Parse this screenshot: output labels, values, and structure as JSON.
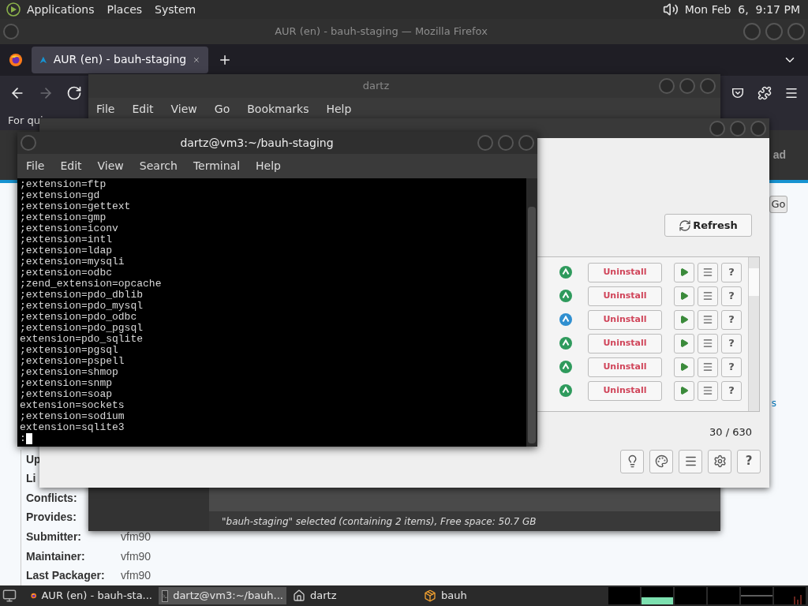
{
  "top_panel": {
    "menus": [
      "Applications",
      "Places",
      "System"
    ],
    "clock": "Mon Feb  6,  9:17 PM"
  },
  "firefox": {
    "title": "AUR (en) - bauh-staging — Mozilla Firefox",
    "tabs": [
      {
        "label": "AUR (en) - bauh-staging",
        "selected": true
      }
    ],
    "nav_buttons": [
      {
        "kind": "back",
        "disabled": false
      },
      {
        "kind": "forward",
        "disabled": true
      },
      {
        "kind": "reload",
        "disabled": false
      }
    ],
    "bookmarks_text": "For qui",
    "header_text": "ad",
    "go_button": "Go",
    "side_text": "s",
    "details": [
      {
        "label": "Up"
      },
      {
        "label": "Li"
      },
      {
        "label": "Conflicts:"
      },
      {
        "label": "Provides:"
      },
      {
        "label": "Submitter:",
        "value": "vfm90"
      },
      {
        "label": "Maintainer:",
        "value": "vfm90"
      },
      {
        "label": "Last Packager:",
        "value": "vfm90"
      }
    ]
  },
  "file_manager": {
    "title": "dartz",
    "menu": [
      "File",
      "Edit",
      "View",
      "Go",
      "Bookmarks",
      "Help"
    ],
    "status": "\"bauh-staging\" selected (containing 2 items), Free space: 50.7 GB"
  },
  "bauh": {
    "refresh": "Refresh",
    "rows": [
      {
        "color": "#2e9a5c",
        "action": "Uninstall",
        "info": "?"
      },
      {
        "color": "#2e9a5c",
        "action": "Uninstall",
        "info": "?"
      },
      {
        "color": "#2f8fd0",
        "action": "Uninstall",
        "info": "?"
      },
      {
        "color": "#2e9a5c",
        "action": "Uninstall",
        "info": "?"
      },
      {
        "color": "#2e9a5c",
        "action": "Uninstall",
        "info": "?"
      },
      {
        "color": "#2e9a5c",
        "action": "Uninstall",
        "info": "?"
      }
    ],
    "count": "30 / 630",
    "help": "?"
  },
  "terminal": {
    "title": "dartz@vm3:~/bauh-staging",
    "menu": [
      "File",
      "Edit",
      "View",
      "Search",
      "Terminal",
      "Help"
    ],
    "lines": [
      ";extension=ftp",
      ";extension=gd",
      ";extension=gettext",
      ";extension=gmp",
      ";extension=iconv",
      ";extension=intl",
      ";extension=ldap",
      ";extension=mysqli",
      ";extension=odbc",
      ";zend_extension=opcache",
      ";extension=pdo_dblib",
      ";extension=pdo_mysql",
      ";extension=pdo_odbc",
      ";extension=pdo_pgsql",
      "extension=pdo_sqlite",
      ";extension=pgsql",
      ";extension=pspell",
      ";extension=shmop",
      ";extension=snmp",
      ";extension=soap",
      "extension=sockets",
      ";extension=sodium",
      "extension=sqlite3"
    ],
    "prompt": ":"
  },
  "taskbar": {
    "items": [
      {
        "kind": "firefox",
        "label": "AUR (en) - bauh-sta...",
        "selected": false
      },
      {
        "kind": "terminal",
        "label": "dartz@vm3:~/bauh...",
        "selected": true
      },
      {
        "kind": "folder",
        "label": "dartz",
        "selected": false
      },
      {
        "kind": "bauh",
        "label": "bauh",
        "selected": false
      }
    ]
  }
}
